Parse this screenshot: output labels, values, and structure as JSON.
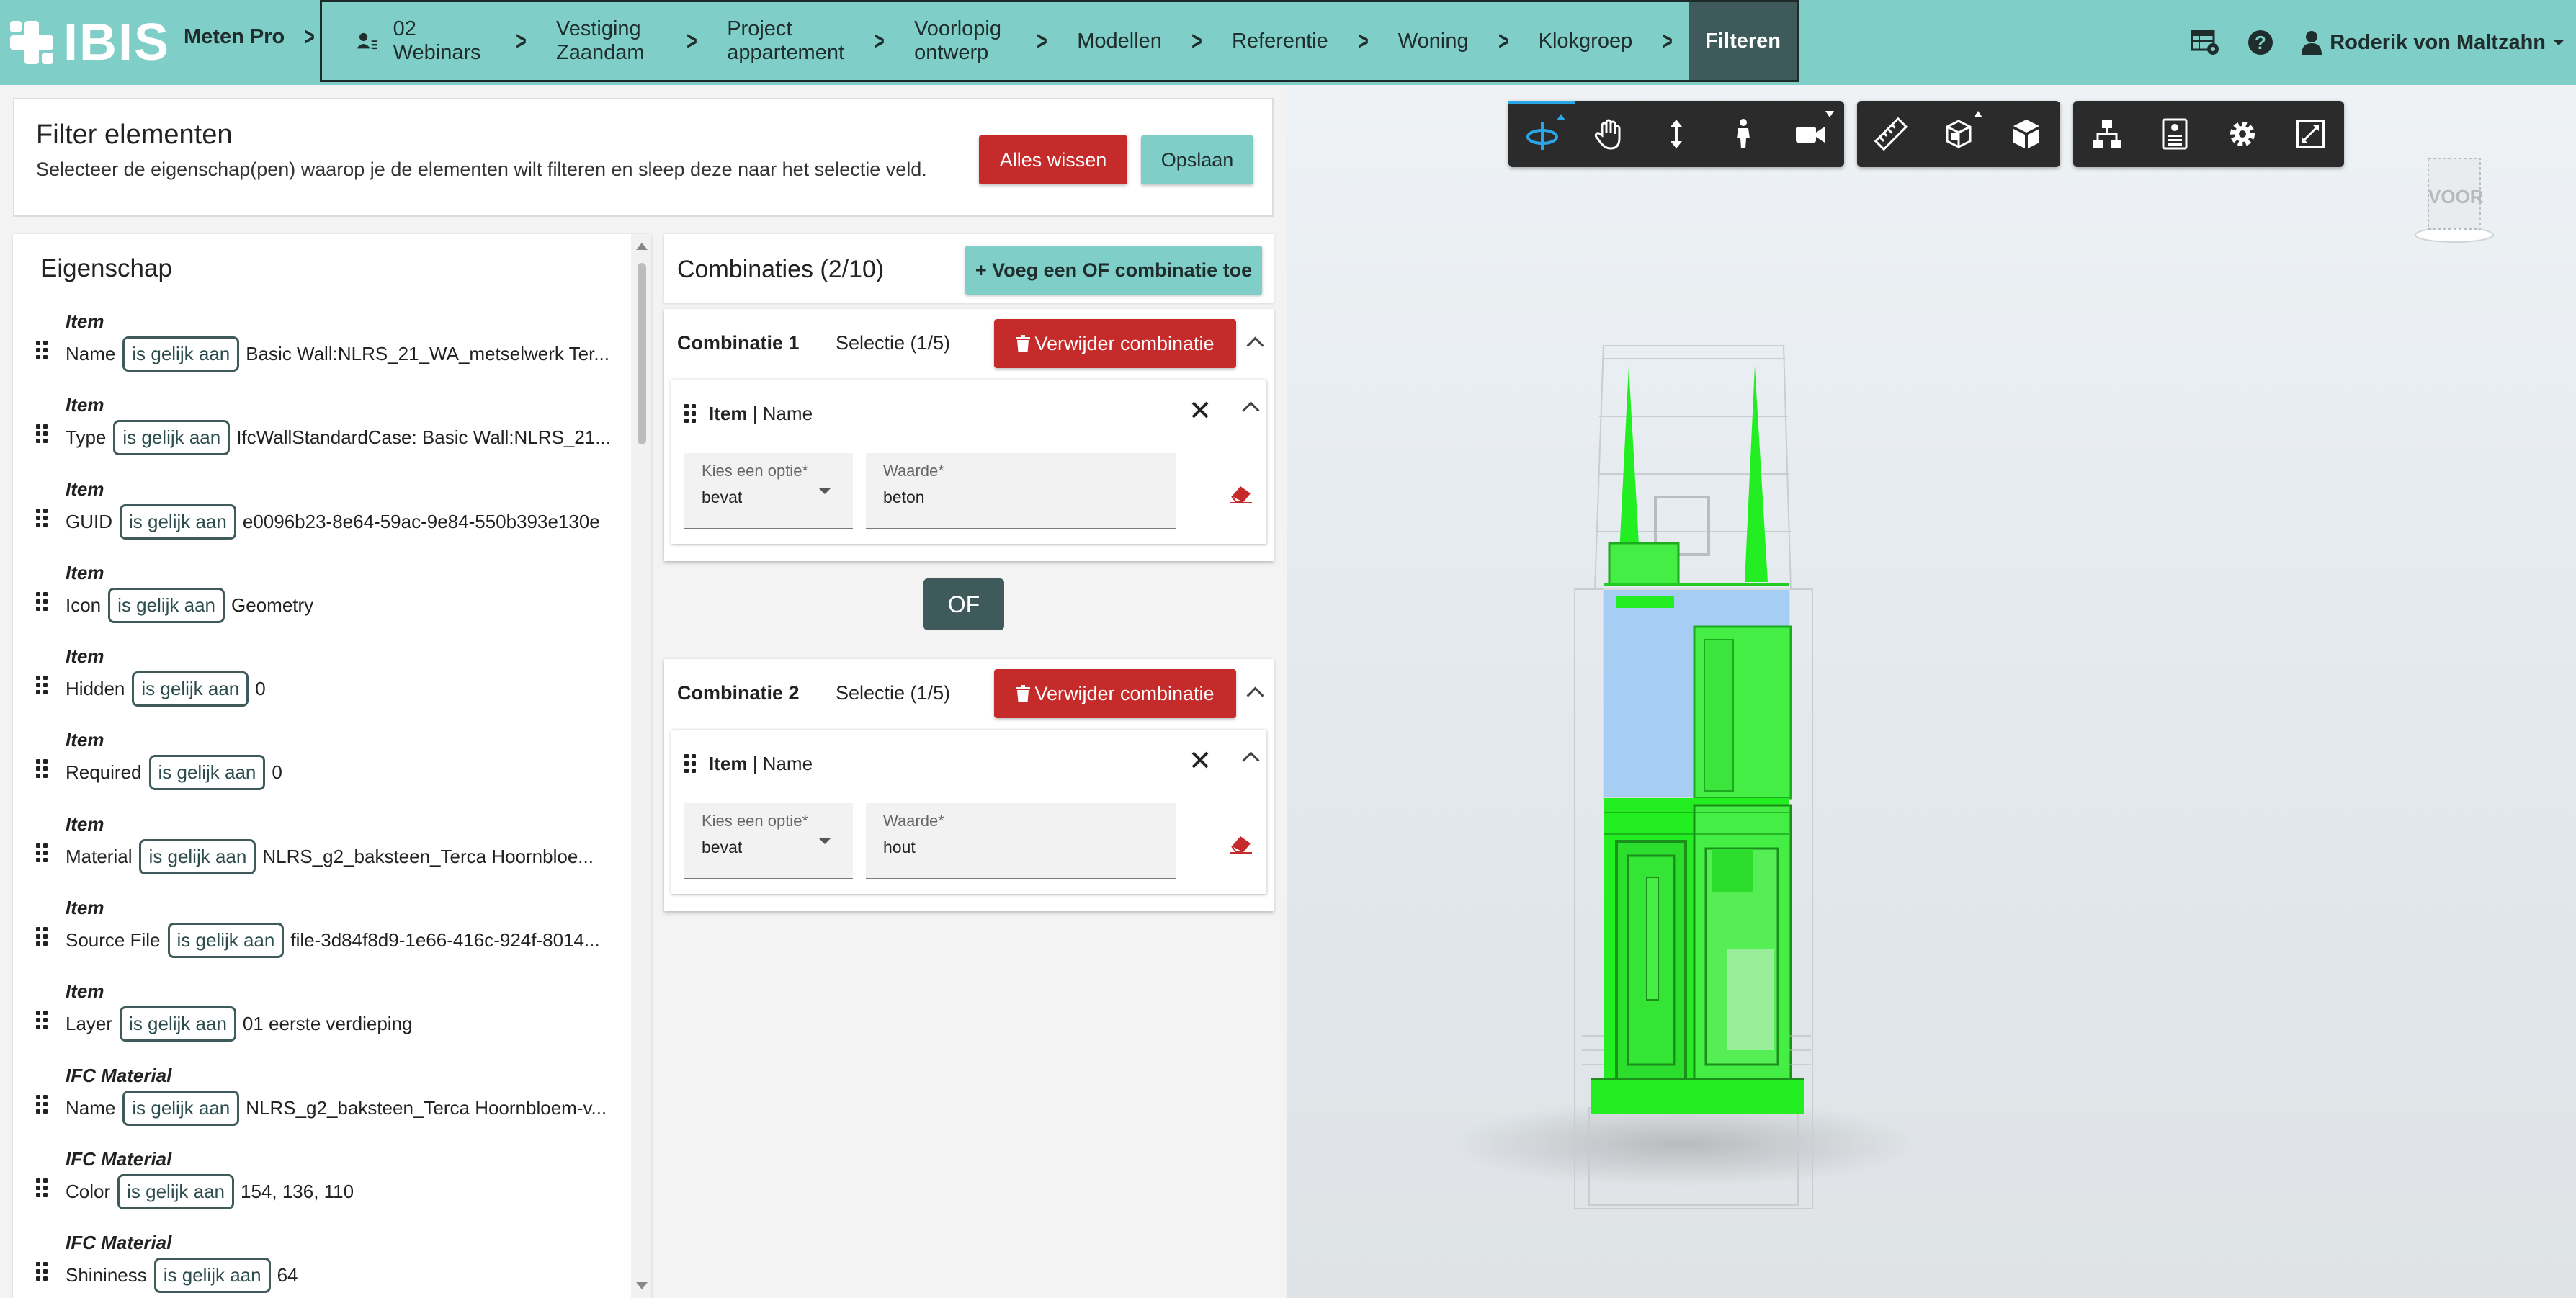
{
  "topbar": {
    "logo_text": "IBIS",
    "app_name": "Meten Pro",
    "breadcrumbs": [
      {
        "label": "02 Webinars",
        "icon": "user-list-icon"
      },
      {
        "label": "Vestiging Zaandam"
      },
      {
        "label": "Project appartement"
      },
      {
        "label": "Voorlopig ontwerp"
      },
      {
        "label": "Modellen"
      },
      {
        "label": "Referentie"
      },
      {
        "label": "Woning"
      },
      {
        "label": "Klokgroep"
      },
      {
        "label": "Filteren",
        "active": true
      }
    ],
    "user_name": "Roderik von Maltzahn"
  },
  "filter": {
    "title": "Filter elementen",
    "subtitle": "Selecteer de eigenschap(pen) waarop je de elementen wilt filteren en sleep deze naar het selectie veld.",
    "clear_label": "Alles wissen",
    "save_label": "Opslaan"
  },
  "properties": {
    "title": "Eigenschap",
    "operator": "is gelijk aan",
    "items": [
      {
        "category": "Item",
        "name": "Name",
        "value": "Basic Wall:NLRS_21_WA_metselwerk Ter..."
      },
      {
        "category": "Item",
        "name": "Type",
        "value": "IfcWallStandardCase: Basic Wall:NLRS_21..."
      },
      {
        "category": "Item",
        "name": "GUID",
        "value": "e0096b23-8e64-59ac-9e84-550b393e130e"
      },
      {
        "category": "Item",
        "name": "Icon",
        "value": "Geometry"
      },
      {
        "category": "Item",
        "name": "Hidden",
        "value": "0"
      },
      {
        "category": "Item",
        "name": "Required",
        "value": "0"
      },
      {
        "category": "Item",
        "name": "Material",
        "value": "NLRS_g2_baksteen_Terca Hoornbloe..."
      },
      {
        "category": "Item",
        "name": "Source File",
        "value": "file-3d84f8d9-1e66-416c-924f-8014..."
      },
      {
        "category": "Item",
        "name": "Layer",
        "value": "01 eerste verdieping"
      },
      {
        "category": "IFC Material",
        "name": "Name",
        "value": "NLRS_g2_baksteen_Terca Hoornbloem-v..."
      },
      {
        "category": "IFC Material",
        "name": "Color",
        "value": "154, 136, 110"
      },
      {
        "category": "IFC Material",
        "name": "Shininess",
        "value": "64"
      }
    ]
  },
  "combinations": {
    "title": "Combinaties (2/10)",
    "add_label": "+ Voeg een OF combinatie toe",
    "or_label": "OF",
    "delete_label": "Verwijder combinatie",
    "option_label": "Kies een optie*",
    "value_label": "Waarde*",
    "cards": [
      {
        "name": "Combinatie 1",
        "selection": "Selectie (1/5)",
        "rule_category": "Item",
        "rule_prop": "Name",
        "option": "bevat",
        "value": "beton"
      },
      {
        "name": "Combinatie 2",
        "selection": "Selectie (1/5)",
        "rule_category": "Item",
        "rule_prop": "Name",
        "option": "bevat",
        "value": "hout"
      }
    ]
  },
  "viewport": {
    "viewcube_label": "VOOR",
    "highlight_color": "#22ee22",
    "glass_color": "#a6cdf4",
    "active_tool_color": "#2aa5e8"
  }
}
